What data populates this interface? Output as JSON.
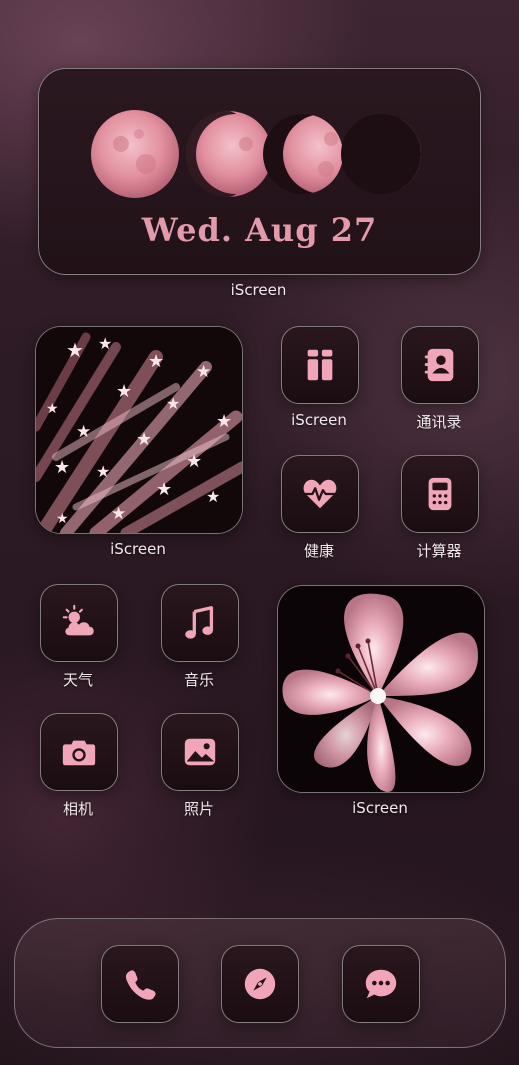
{
  "widgets": {
    "moon": {
      "date": "Wed. Aug 27",
      "label": "iScreen"
    },
    "stars_photo": {
      "label": "iScreen"
    },
    "flower_photo": {
      "label": "iScreen"
    }
  },
  "apps": [
    {
      "label": "iScreen",
      "icon": "widget-grid-icon"
    },
    {
      "label": "通讯录",
      "icon": "contacts-icon"
    },
    {
      "label": "健康",
      "icon": "health-heart-icon"
    },
    {
      "label": "计算器",
      "icon": "calculator-icon"
    },
    {
      "label": "天气",
      "icon": "weather-icon"
    },
    {
      "label": "音乐",
      "icon": "music-note-icon"
    },
    {
      "label": "相机",
      "icon": "camera-icon"
    },
    {
      "label": "照片",
      "icon": "photos-icon"
    }
  ],
  "dock": [
    {
      "icon": "phone-icon"
    },
    {
      "icon": "compass-icon"
    },
    {
      "icon": "messages-icon"
    }
  ],
  "theme": {
    "accent": "#e39aab",
    "icon_pink": "#f0a6b8"
  }
}
